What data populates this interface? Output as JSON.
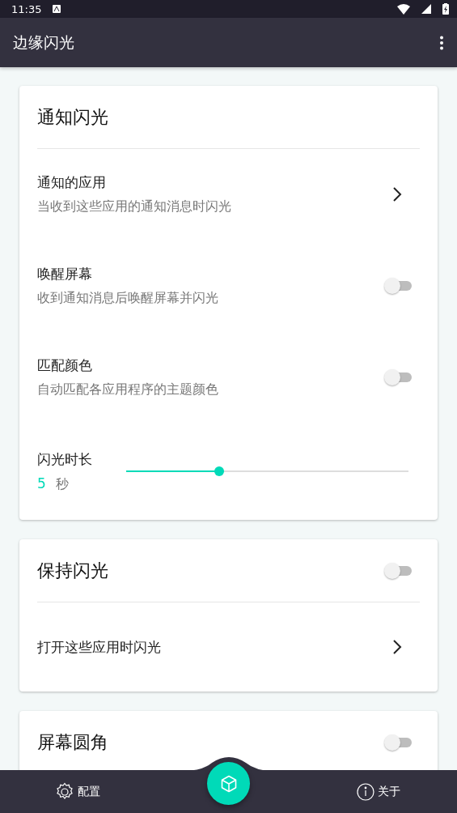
{
  "status_bar": {
    "time": "11:35"
  },
  "app_bar": {
    "title": "边缘闪光"
  },
  "cards": [
    {
      "title": "通知闪光",
      "items": [
        {
          "kind": "link",
          "title": "通知的应用",
          "subtitle": "当收到这些应用的通知消息时闪光"
        },
        {
          "kind": "toggle",
          "title": "唤醒屏幕",
          "subtitle": "收到通知消息后唤醒屏幕并闪光",
          "on": false
        },
        {
          "kind": "toggle",
          "title": "匹配颜色",
          "subtitle": "自动匹配各应用程序的主题颜色",
          "on": false
        },
        {
          "kind": "slider",
          "title": "闪光时长",
          "value": "5",
          "unit": "秒",
          "level": 0.33
        }
      ]
    },
    {
      "title": "保持闪光",
      "toggle": {
        "on": false
      },
      "items": [
        {
          "kind": "link",
          "title": "打开这些应用时闪光"
        }
      ]
    },
    {
      "title": "屏幕圆角",
      "toggle": {
        "on": false
      }
    }
  ],
  "bottom_nav": [
    {
      "label": "配置"
    },
    {
      "label": "关于"
    }
  ]
}
